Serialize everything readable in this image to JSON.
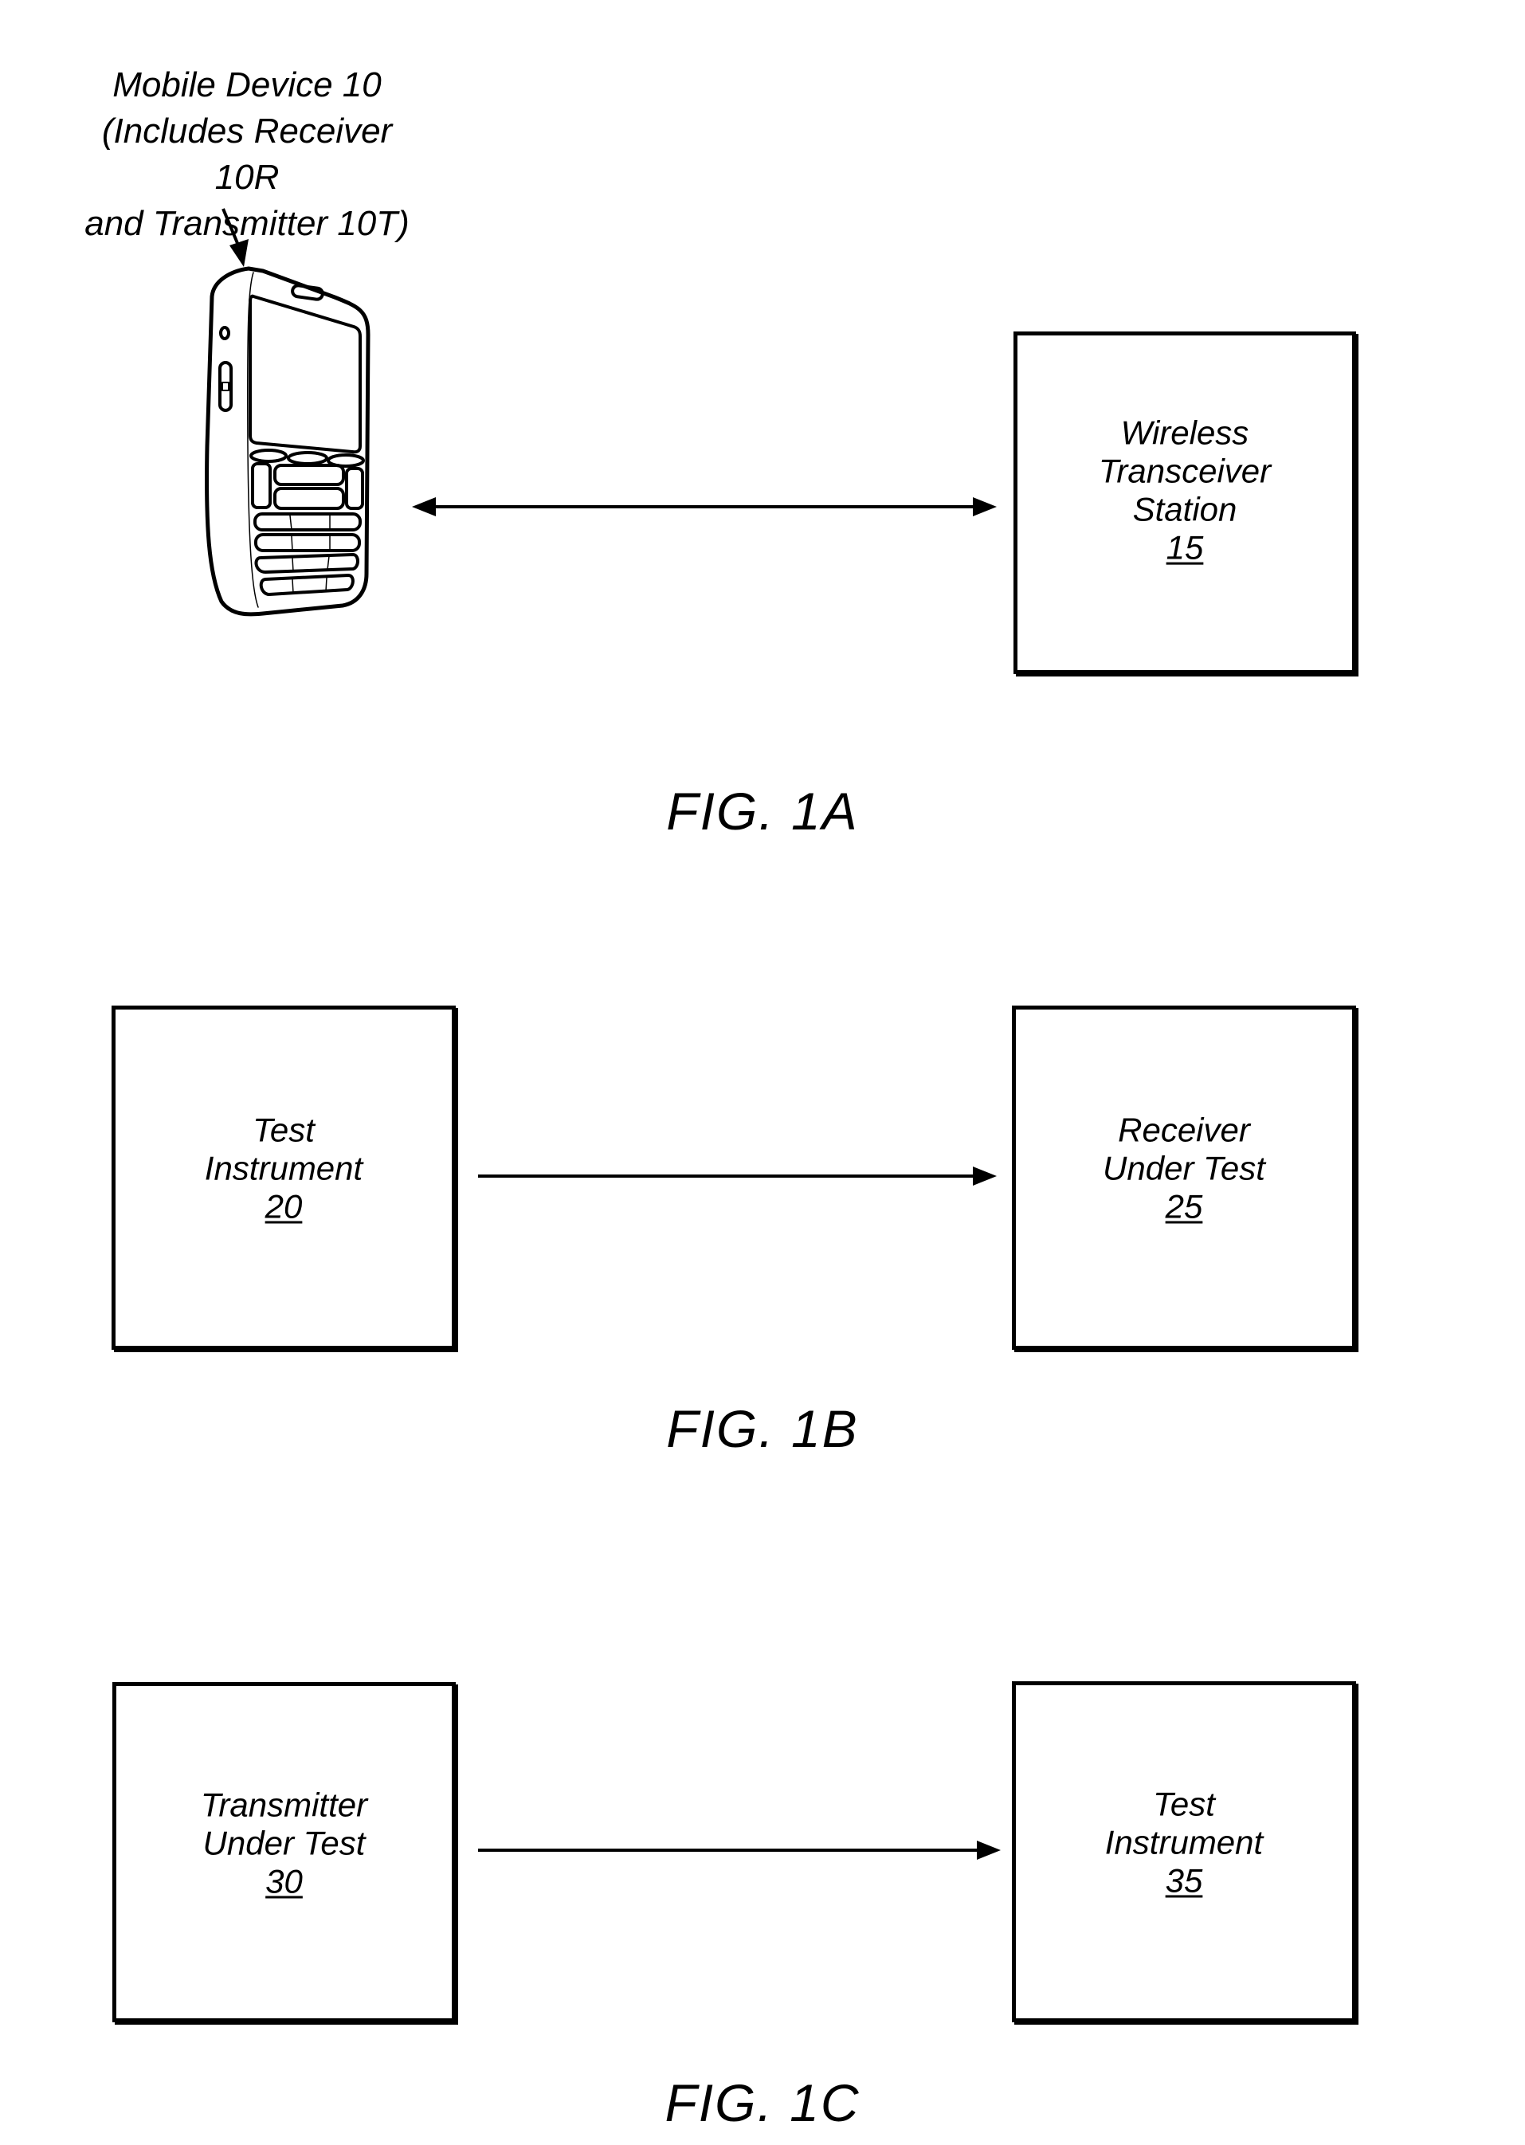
{
  "figure_1a": {
    "fig_label": "FIG. 1A",
    "device_label": {
      "line1": "Mobile Device 10",
      "line2": "(Includes Receiver 10R",
      "line3": "and Transmitter 10T)"
    },
    "device_icon": "mobile-phone-icon",
    "station_box": {
      "lines": [
        "Wireless",
        "Transceiver",
        "Station"
      ],
      "ref": "15"
    },
    "link": "bidirectional-arrow"
  },
  "figure_1b": {
    "fig_label": "FIG. 1B",
    "left_box": {
      "lines": [
        "Test",
        "Instrument"
      ],
      "ref": "20"
    },
    "right_box": {
      "lines": [
        "Receiver",
        "Under Test"
      ],
      "ref": "25"
    },
    "link": "arrow-right"
  },
  "figure_1c": {
    "fig_label": "FIG. 1C",
    "left_box": {
      "lines": [
        "Transmitter",
        "Under Test"
      ],
      "ref": "30"
    },
    "right_box": {
      "lines": [
        "Test",
        "Instrument"
      ],
      "ref": "35"
    },
    "link": "arrow-right"
  }
}
